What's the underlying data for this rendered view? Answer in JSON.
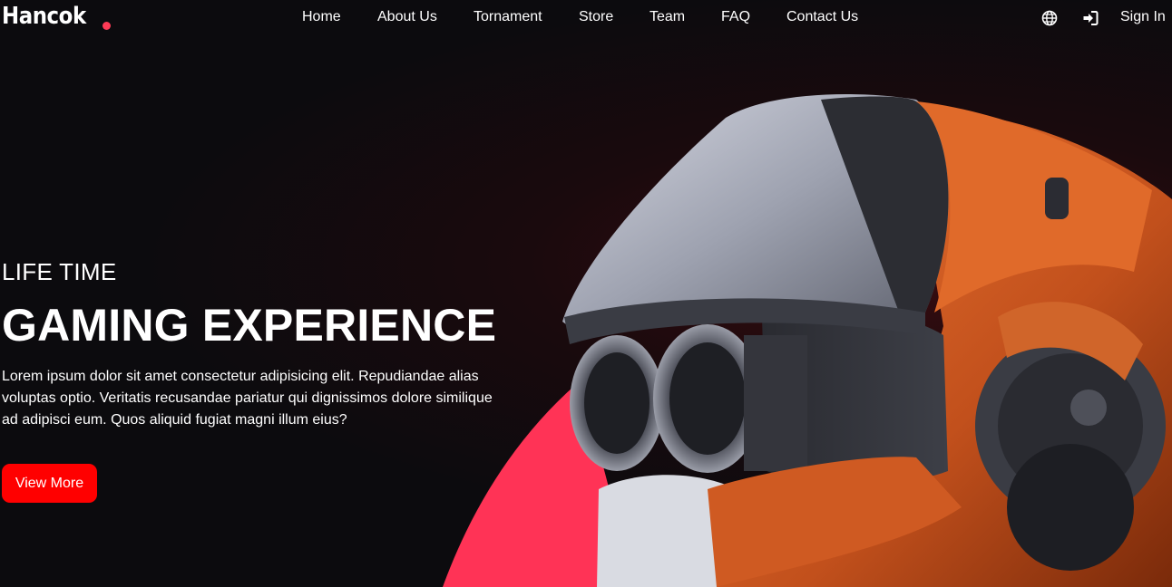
{
  "brand": {
    "name": "Hancok",
    "accent": "#ff3b56"
  },
  "nav": {
    "items": [
      {
        "label": "Home"
      },
      {
        "label": "About Us"
      },
      {
        "label": "Tornament"
      },
      {
        "label": "Store"
      },
      {
        "label": "Team"
      },
      {
        "label": "FAQ"
      },
      {
        "label": "Contact Us"
      }
    ]
  },
  "header_actions": {
    "language_icon": "globe-icon",
    "login_icon": "sign-in-icon",
    "signin_label": "Sign In"
  },
  "hero": {
    "eyebrow": "LIFE TIME",
    "title": "GAMING EXPERIENCE",
    "description": "Lorem ipsum dolor sit amet consectetur adipisicing elit. Repudiandae alias voluptas optio. Veritatis recusandae pariatur qui dignissimos dolore similique ad adipisci eum. Quos aliquid fugiat magni illum eius?",
    "cta_label": "View More",
    "cta_color": "#ff0000",
    "image": "robot-helmet-illustration"
  }
}
